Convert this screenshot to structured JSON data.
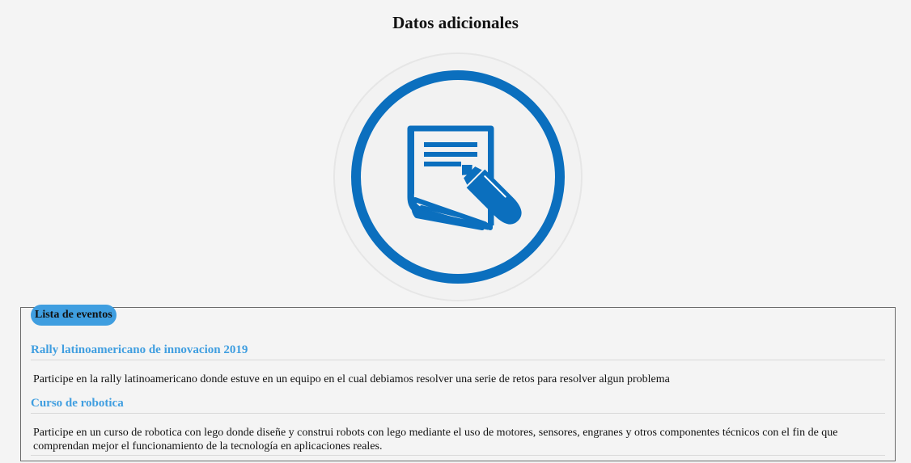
{
  "page": {
    "title": "Datos adicionales"
  },
  "emblem": {
    "icon": "document-with-fountain-pen-icon",
    "accent_color": "#0b6fbe"
  },
  "events_panel": {
    "legend": "Lista de eventos",
    "events": [
      {
        "title": "Rally latinoamericano de innovacion 2019",
        "description": "Participe en la rally latinoamericano donde estuve en un equipo en el cual debiamos resolver una serie de retos para resolver algun problema"
      },
      {
        "title": "Curso de robotica",
        "description": "Participe en un curso de robotica con lego donde diseñe y construi robots con lego mediante el uso de motores, sensores, engranes y otros componentes técnicos con el fin de que comprendan mejor el funcionamiento de la tecnología en aplicaciones reales."
      }
    ]
  },
  "colors": {
    "background": "#f4f4f4",
    "link_blue": "#3f9ee0",
    "icon_blue": "#0b6fbe"
  }
}
